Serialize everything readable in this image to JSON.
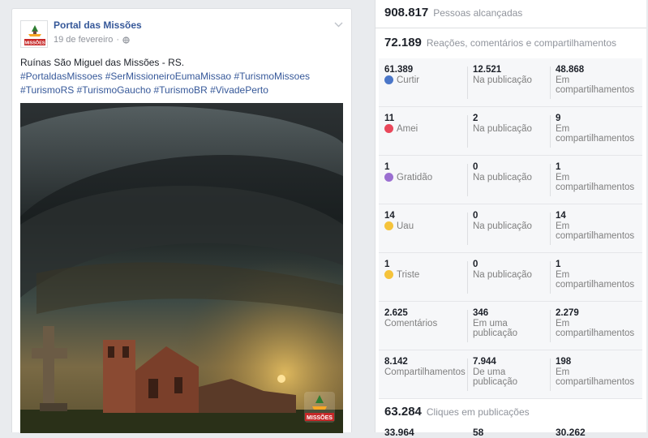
{
  "post": {
    "page_name": "Portal das Missões",
    "date": "19 de fevereiro",
    "caption_text": "Ruínas São Miguel das Missões - RS.",
    "hashtags_line1": "#PortaldasMissoes #SerMissioneiroEumaMissao #TurismoMissoes",
    "hashtags_line2": "#TurismoRS #TurismoGaucho #TurismoBR #VivadePerto",
    "logo_text": "MISSÕES",
    "watermark_text": "MISSÕES"
  },
  "stats": {
    "reach_value": "908.817",
    "reach_label": "Pessoas alcançadas",
    "engagement_value": "72.189",
    "engagement_label": "Reações, comentários e compartilhamentos",
    "rows": [
      {
        "total": "61.389",
        "label": "Curtir",
        "icon": "like-icon",
        "post": "12.521",
        "post_label": "Na publicação",
        "shares": "48.868",
        "shares_label": "Em compartilhamentos"
      },
      {
        "total": "11",
        "label": "Amei",
        "icon": "love-icon",
        "post": "2",
        "post_label": "Na publicação",
        "shares": "9",
        "shares_label": "Em compartilhamentos"
      },
      {
        "total": "1",
        "label": "Gratidão",
        "icon": "gratitude-icon",
        "post": "0",
        "post_label": "Na publicação",
        "shares": "1",
        "shares_label": "Em compartilhamentos"
      },
      {
        "total": "14",
        "label": "Uau",
        "icon": "wow-icon",
        "post": "0",
        "post_label": "Na publicação",
        "shares": "14",
        "shares_label": "Em compartilhamentos"
      },
      {
        "total": "1",
        "label": "Triste",
        "icon": "sad-icon",
        "post": "0",
        "post_label": "Na publicação",
        "shares": "1",
        "shares_label": "Em compartilhamentos"
      },
      {
        "total": "2.625",
        "label": "Comentários",
        "icon": "",
        "post": "346",
        "post_label": "Em uma publicação",
        "shares": "2.279",
        "shares_label": "Em compartilhamentos"
      },
      {
        "total": "8.142",
        "label": "Compartilhamentos",
        "icon": "",
        "post": "7.944",
        "post_label": "De uma publicação",
        "shares": "198",
        "shares_label": "Em compartilhamentos"
      }
    ],
    "clicks_value": "63.284",
    "clicks_label": "Cliques em publicações",
    "clicks_partial": [
      "33.964",
      "58",
      "30.262"
    ]
  },
  "colors": {
    "link_blue": "#365899",
    "muted_gray": "#90949c",
    "panel_bg": "#f6f7f9"
  }
}
